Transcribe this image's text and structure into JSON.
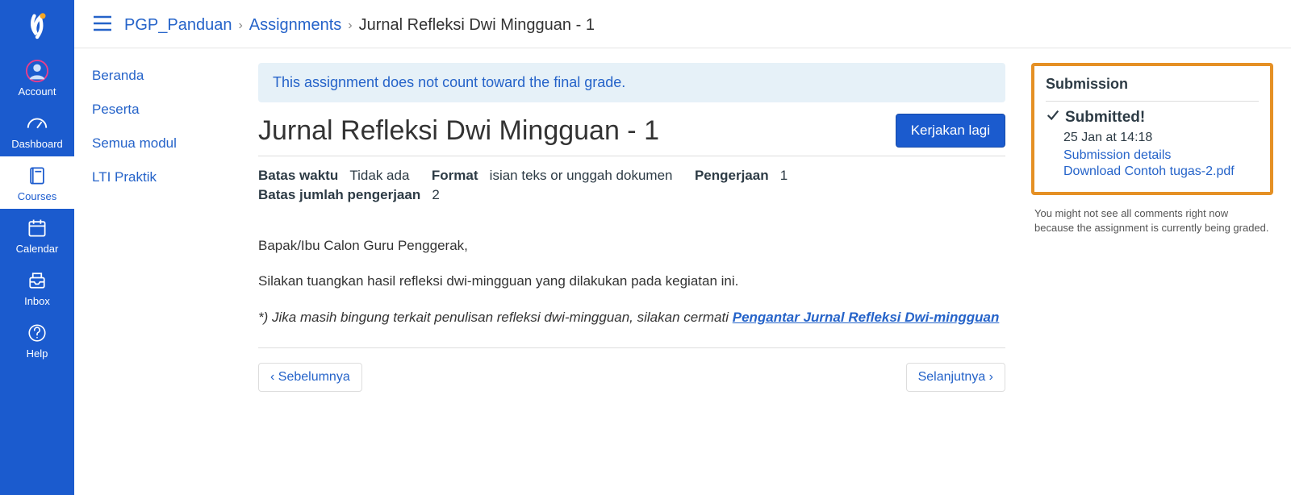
{
  "global_nav": {
    "account": "Account",
    "dashboard": "Dashboard",
    "courses": "Courses",
    "calendar": "Calendar",
    "inbox": "Inbox",
    "help": "Help"
  },
  "breadcrumbs": {
    "course": "PGP_Panduan",
    "section": "Assignments",
    "current": "Jurnal Refleksi Dwi Mingguan - 1"
  },
  "course_nav": {
    "home": "Beranda",
    "people": "Peserta",
    "modules": "Semua modul",
    "lti": "LTI Praktik"
  },
  "alert": "This assignment does not count toward the final grade.",
  "title": "Jurnal Refleksi Dwi Mingguan - 1",
  "action_button": "Kerjakan lagi",
  "meta": {
    "due_label": "Batas waktu",
    "due_value": "Tidak ada",
    "format_label": "Format",
    "format_value": "isian teks or unggah dokumen",
    "attempts_label": "Pengerjaan",
    "attempts_value": "1",
    "allowed_label": "Batas jumlah pengerjaan",
    "allowed_value": "2"
  },
  "body": {
    "p1": "Bapak/Ibu Calon Guru Penggerak,",
    "p2": "Silakan tuangkan hasil refleksi dwi-mingguan yang dilakukan pada kegiatan ini.",
    "p3_prefix": "*) Jika masih bingung terkait penulisan refleksi dwi-mingguan, silakan cermati ",
    "p3_link": "Pengantar Jurnal Refleksi Dwi-mingguan"
  },
  "pager": {
    "prev": "Sebelumnya",
    "next": "Selanjutnya"
  },
  "sidebar": {
    "heading": "Submission",
    "submitted": "Submitted!",
    "date": "25 Jan at 14:18",
    "details_link": "Submission details",
    "download_link": "Download Contoh tugas-2.pdf",
    "note": "You might not see all comments right now because the assignment is currently being graded."
  }
}
